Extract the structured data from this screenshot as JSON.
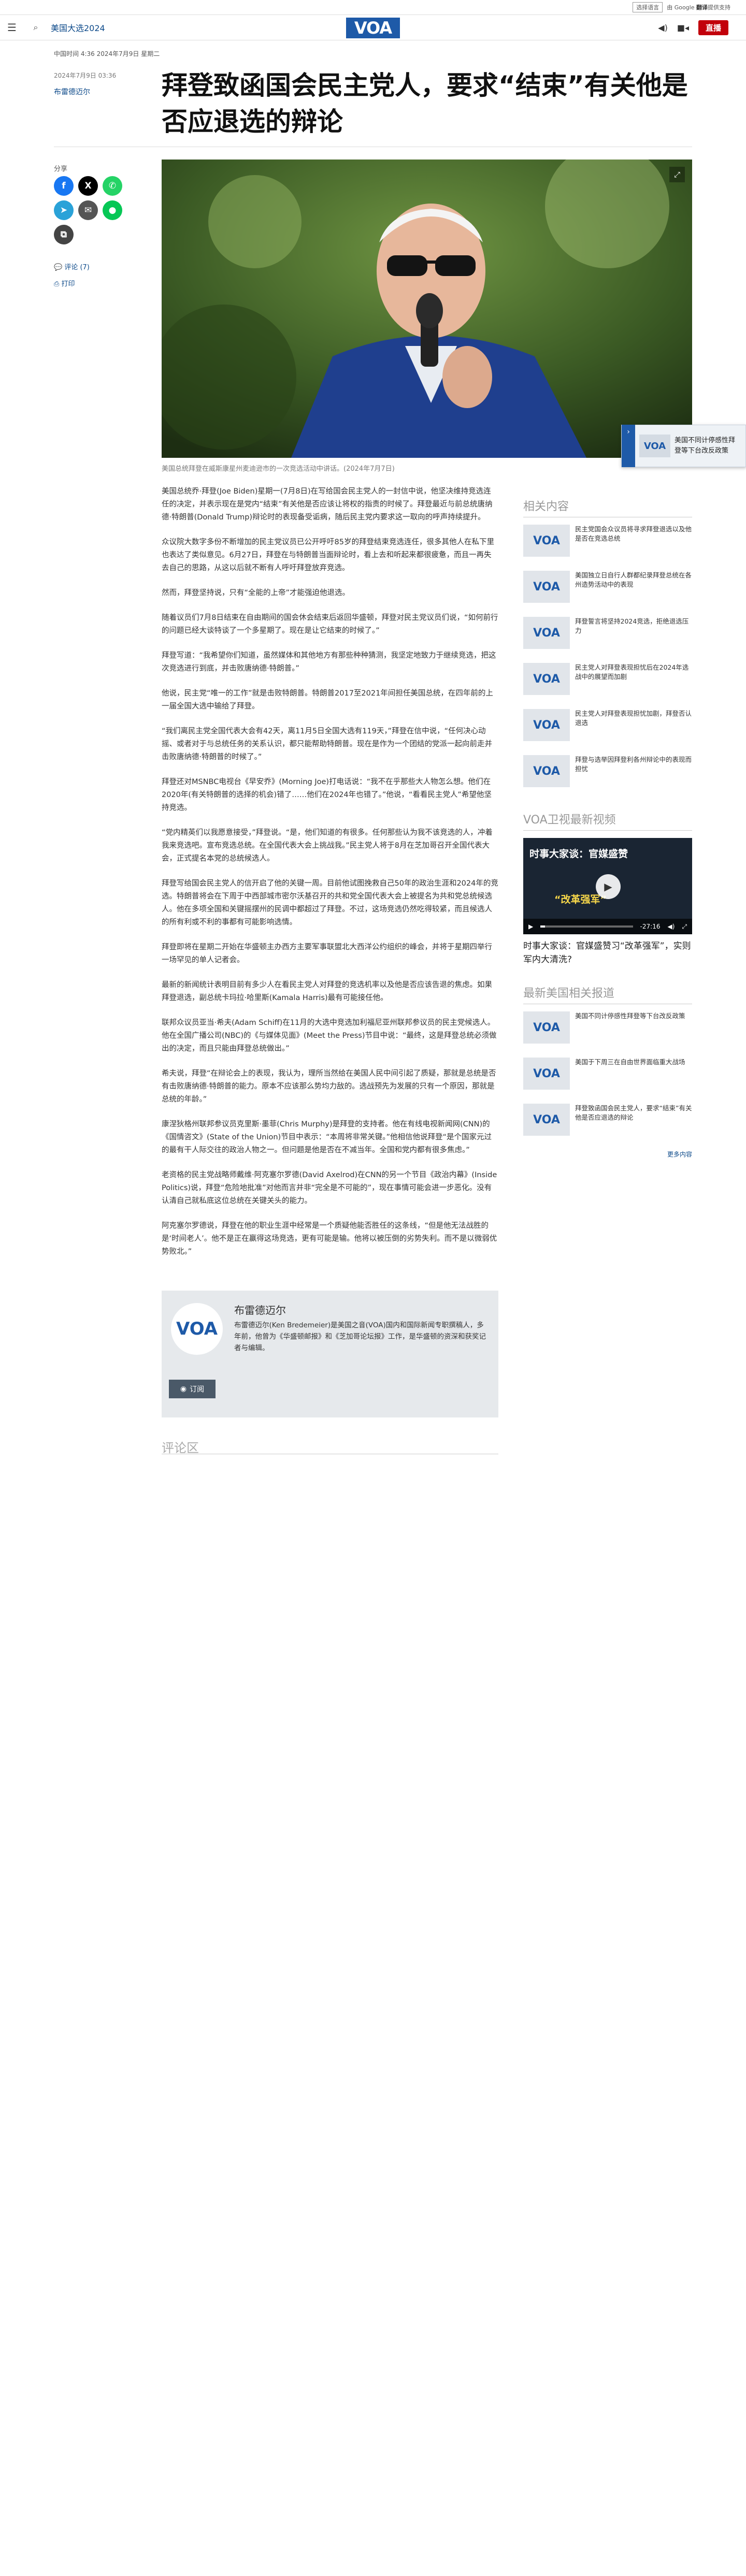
{
  "translate": {
    "select_label": "选择语言",
    "powered_by": "由 Google",
    "brand": "翻译",
    "suffix": "提供支持"
  },
  "header": {
    "menu_icon": "menu-icon",
    "search_icon": "search-icon",
    "section_link": "美国大选2024",
    "logo": "VOA",
    "audio_icon": "audio-icon",
    "video_icon": "video-icon",
    "live_label": "直播"
  },
  "article": {
    "update_line": "中国时间 4:36 2024年7月9日 星期二",
    "pub_date": "2024年7月9日 03:36",
    "author": "布雷德迈尔",
    "headline": "拜登致函国会民主党人，要求“结束”有关他是否应退选的辩论",
    "caption": "美国总统拜登在威斯康星州麦迪逊市的一次竞选活动中讲话。(2024年7月7日)",
    "paragraphs": [
      "美国总统乔·拜登(Joe Biden)星期一(7月8日)在写给国会民主党人的一封信中说，他坚决维持竞选连任的决定，并表示现在是党内“结束”有关他是否应该让将权的指责的时候了。拜登最近与前总统唐纳德·特朗普(Donald Trump)辩论时的表现备受诟病，随后民主党内要求这一取向的呼声持续提升。",
      "众议院大数字多份不断增加的民主党议员已公开呼吁85岁的拜登结束竞选连任，很多其他人在私下里也表达了类似意见。6月27日，拜登在与特朗普当面辩论时，看上去和听起来都很疲惫，而且一再失去自己的思路，从这以后就不断有人呼吁拜登放弃竞选。",
      "然而，拜登坚持说，只有“全能的上帝”才能强迫他退选。",
      "随着议员们7月8日结束在自由期间的国会休会结束后返回华盛顿，拜登对民主党议员们说，“如何前行的问题已经大谈特谈了一个多星期了。现在是让它结束的时候了。”",
      "拜登写道：“我希望你们知道，虽然媒体和其他地方有那些种种猜测，我坚定地致力于继续竞选，把这次竞选进行到底，并击败唐纳德·特朗普。”",
      "他说，民主党“唯一的工作”就是击败特朗普。特朗普2017至2021年间担任美国总统，在四年前的上一届全国大选中输给了拜登。",
      "“我们离民主党全国代表大会有42天，离11月5日全国大选有119天，”拜登在信中说，“任何决心动摇、或者对于与总统任务的关系认识，都只能帮助特朗普。现在是作为一个团结的党派一起向前走并击败唐纳德·特朗普的时候了。”",
      "拜登还对MSNBC电视台《早安乔》(Morning Joe)打电话说：“我不在乎那些大人物怎么想。他们在2020年(有关特朗普的选择的机会)错了……他们在2024年也错了。”他说，“看看民主党人”希望他坚持竞选。",
      "“党内精英们以我愿意接受，”拜登说。“是，他们知道的有很多。任何那些认为我不该竞选的人，冲着我来竞选吧。宣布竞选总统。在全国代表大会上挑战我。”民主党人将于8月在芝加哥召开全国代表大会，正式提名本党的总统候选人。",
      "拜登写给国会民主党人的信开启了他的关键一周。目前他试图挽救自己50年的政治生涯和2024年的竞选。特朗普将会在下周于中西部城市密尔沃基召开的共和党全国代表大会上被提名为共和党总统候选人。他在多项全国和关键摇摆州的民调中都超过了拜登。不过，这场竞选仍然吃得较紧，而且候选人的所有利或不利的事都有可能影响选情。",
      "拜登即将在星期二开始在华盛顿主办西方主要军事联盟北大西洋公约组织的峰会，并将于星期四举行一场罕见的单人记者会。",
      "最新的新闻统计表明目前有多少人在看民主党人对拜登的竞选机率以及他是否应该告退的焦虑。如果拜登退选，副总统卡玛拉·哈里斯(Kamala Harris)最有可能接任他。",
      "联邦众议员亚当·希夫(Adam Schiff)在11月的大选中竞选加利福尼亚州联邦参议员的民主党候选人。他在全国广播公司(NBC)的《与媒体见面》(Meet the Press)节目中说：“最终，这是拜登总统必须做出的决定，而且只能由拜登总统做出。”",
      "希夫说，拜登“在辩论会上的表现，我认为，理所当然给在美国人民中间引起了质疑，那就是总统是否有击败唐纳德·特朗普的能力。原本不应该那么势均力敌的。选战预先为发展的只有一个原因，那就是总统的年龄。”",
      "康涅狄格州联邦参议员克里斯·墨菲(Chris Murphy)是拜登的支持者。他在有线电视新闻网(CNN)的《国情咨文》(State of the Union)节目中表示：“本周将非常关键。”他相信他说拜登“是个国家元过的最有干人际交往的政治人物之一。但问题是他是否在不减当年。全国和党内都有很多焦虑。”",
      "老资格的民主党战略师戴维·阿克塞尔罗德(David Axelrod)在CNN的另一个节目《政治内幕》(Inside Politics)说，拜登“危险地批准”对他而言并非“完全是不可能的”，现在事情可能会进一步恶化。没有认清自己就私底这位总统在关键关头的能力。",
      "阿克塞尔罗德说，拜登在他的职业生涯中经常是一个质疑他能否胜任的这条线，“但是他无法战胜的是‘时间老人’。他不是正在赢得这场竞选，更有可能是输。他将以被压倒的劣势失利。而不是以微弱优势败北。”"
    ]
  },
  "share": {
    "label": "分享",
    "comments": "评论 (7)",
    "print": "打印"
  },
  "float_card": {
    "title": "美国不同计停感性拜登等下台改反政策"
  },
  "author_box": {
    "name": "布雷德迈尔",
    "bio": "布雷德迈尔(Ken Bredemeier)是美国之音(VOA)国内和国际新闻专职撰稿人，多年前，他曾为《华盛顿邮报》和《芝加哥论坛报》工作，是华盛顿的资深和获奖记者与编辑。",
    "subscribe": "订阅"
  },
  "comments_heading": "评论区",
  "sidebar": {
    "related_title": "相关内容",
    "related": [
      "民主党国会众议员将寻求拜登退选以及他是否在竞选总统",
      "美国独立日自行人群都纪录拜登总统在各州造势活动中的表现",
      "拜登誓言将坚持2024竞选，拒绝退选压力",
      "民主党人对拜登表现担忧后在2024年选战中的展望而加剧",
      "民主党人对拜登表现担忧加剧，拜登否认退选",
      "拜登与选举因拜登利各州辩论中的表现而担忧"
    ],
    "video_title": "VOA卫视最新视频",
    "video_overlay": "时事大家谈：官媒盛赞",
    "video_overlay_sub": "“改革强军”",
    "video_time": "-27:16",
    "video_progress": 0.05,
    "video_caption": "时事大家谈：官媒盛赞习“改革强军”，实则军内大清洗?",
    "latest_title": "最新美国相关报道",
    "latest": [
      "美国不同计停感性拜登等下台改反政策",
      "美国于下周三在自由世界面临重大战场",
      "拜登致函国会民主党人，要求“结束”有关他是否应退选的辩论"
    ],
    "more": "更多内容"
  }
}
